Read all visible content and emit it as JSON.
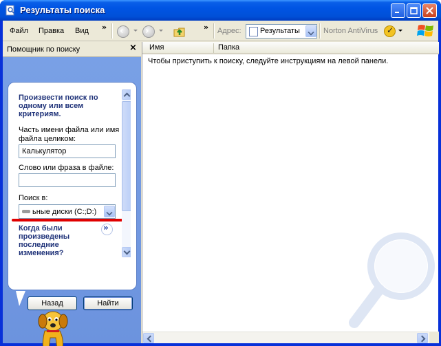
{
  "window": {
    "title": "Результаты поиска"
  },
  "menubar": {
    "file": "Файл",
    "edit": "Правка",
    "view": "Вид",
    "more": "»"
  },
  "toolbar": {
    "more": "»",
    "address_label": "Адрес:",
    "address_value": "Результаты",
    "norton": "Norton AntiVirus"
  },
  "search_pane": {
    "header": "Помощник по поиску",
    "close": "×",
    "heading": [
      "Произвести поиск по",
      "одному или всем",
      "критериям."
    ],
    "filename_label": [
      "Часть имени файла или имя",
      "файла целиком:"
    ],
    "filename_value": "Калькулятор",
    "phrase_label": "Слово или фраза в файле:",
    "phrase_value": "",
    "look_in_label": "Поиск в:",
    "look_in_value": "ьные диски (C:;D:)",
    "when_heading": [
      "Когда были",
      "произведены",
      "последние",
      "изменения?"
    ],
    "back_button": "Назад",
    "find_button": "Найти"
  },
  "results": {
    "columns": [
      "Имя",
      "Папка"
    ],
    "hint": "Чтобы приступить к поиску, следуйте инструкциям на левой панели."
  },
  "colors": {
    "title_bar": "#0054e3",
    "pane_background": "#7aa1e6",
    "highlight_line": "#e00000"
  }
}
